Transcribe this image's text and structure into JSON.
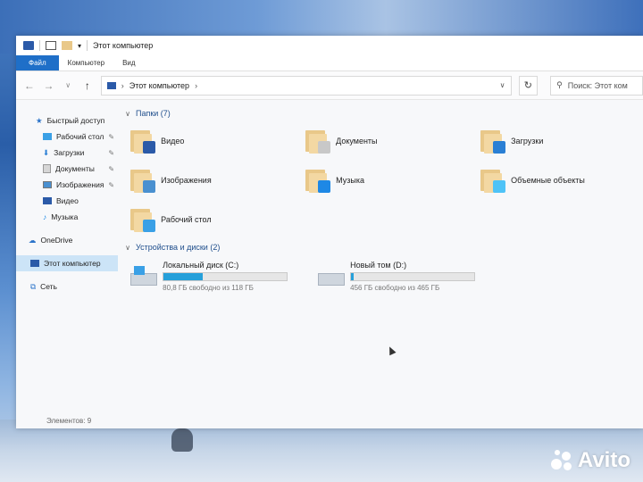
{
  "window": {
    "title": "Этот компьютер"
  },
  "ribbon": {
    "tabs": [
      {
        "label": "Файл",
        "active": true
      },
      {
        "label": "Компьютер"
      },
      {
        "label": "Вид"
      }
    ]
  },
  "navbar": {
    "breadcrumb": "Этот компьютер",
    "search_placeholder": "Поиск: Этот ком"
  },
  "sidebar": {
    "items": [
      {
        "label": "Быстрый доступ",
        "icon": "star-icon",
        "pinned": false
      },
      {
        "label": "Рабочий стол",
        "icon": "desktop-icon",
        "pinned": true
      },
      {
        "label": "Загрузки",
        "icon": "download-icon",
        "pinned": true
      },
      {
        "label": "Документы",
        "icon": "documents-icon",
        "pinned": true
      },
      {
        "label": "Изображения",
        "icon": "pictures-icon",
        "pinned": true
      },
      {
        "label": "Видео",
        "icon": "video-icon",
        "pinned": false
      },
      {
        "label": "Музыка",
        "icon": "music-icon",
        "pinned": false
      },
      {
        "label": "OneDrive",
        "icon": "cloud-icon",
        "pinned": false
      },
      {
        "label": "Этот компьютер",
        "icon": "computer-icon",
        "selected": true
      },
      {
        "label": "Сеть",
        "icon": "network-icon",
        "pinned": false
      }
    ]
  },
  "content": {
    "folders_header": "Папки (7)",
    "folders": [
      {
        "label": "Видео",
        "badge_color": "#2b5aa8"
      },
      {
        "label": "Документы",
        "badge_color": "#c8c8c8"
      },
      {
        "label": "Загрузки",
        "badge_color": "#2a7fd4"
      },
      {
        "label": "Изображения",
        "badge_color": "#4a90d0"
      },
      {
        "label": "Музыка",
        "badge_color": "#1e88e5"
      },
      {
        "label": "Объемные объекты",
        "badge_color": "#4fc3f7"
      },
      {
        "label": "Рабочий стол",
        "badge_color": "#3aa0e6"
      }
    ],
    "drives_header": "Устройства и диски (2)",
    "drives": [
      {
        "name": "Локальный диск (C:)",
        "free_text": "80,8 ГБ свободно из 118 ГБ",
        "used_fraction": 0.32
      },
      {
        "name": "Новый том (D:)",
        "free_text": "456 ГБ свободно из 465 ГБ",
        "used_fraction": 0.02
      }
    ]
  },
  "status_bar": {
    "items_count": "Элементов: 9"
  },
  "watermark": {
    "text": "Avito"
  },
  "colors": {
    "accent": "#1f6fc8",
    "selection": "#cce4f7",
    "drive_bar": "#26a0da",
    "header_text": "#1f4e8c"
  }
}
